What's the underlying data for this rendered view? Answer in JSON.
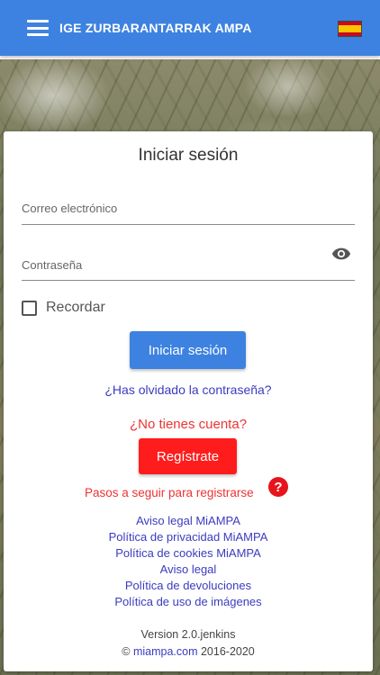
{
  "appbar": {
    "title": "IGE ZURBARANTARRAK AMPA",
    "language_flag": "es-flag-icon"
  },
  "colors": {
    "primary": "#3d82e0",
    "danger": "#ff1c1c",
    "link": "#3b3bc0"
  },
  "login": {
    "title": "Iniciar sesión",
    "email_label": "Correo electrónico",
    "password_label": "Contraseña",
    "remember_label": "Recordar",
    "submit_label": "Iniciar sesión",
    "forgot_label": "¿Has olvidado la contraseña?",
    "no_account": "¿No tienes cuenta?",
    "register_label": "Regístrate",
    "steps_label": "Pasos a seguir para registrarse",
    "help_glyph": "?"
  },
  "links": [
    "Aviso legal MiAMPA",
    "Política de privacidad MiAMPA",
    "Política de cookies MiAMPA",
    "Aviso legal",
    "Política de devoluciones",
    "Política de uso de imágenes"
  ],
  "footer": {
    "version": "Version 2.0.jenkins",
    "copyright_symbol": "©",
    "site": "miampa.com",
    "years": "2016-2020"
  }
}
